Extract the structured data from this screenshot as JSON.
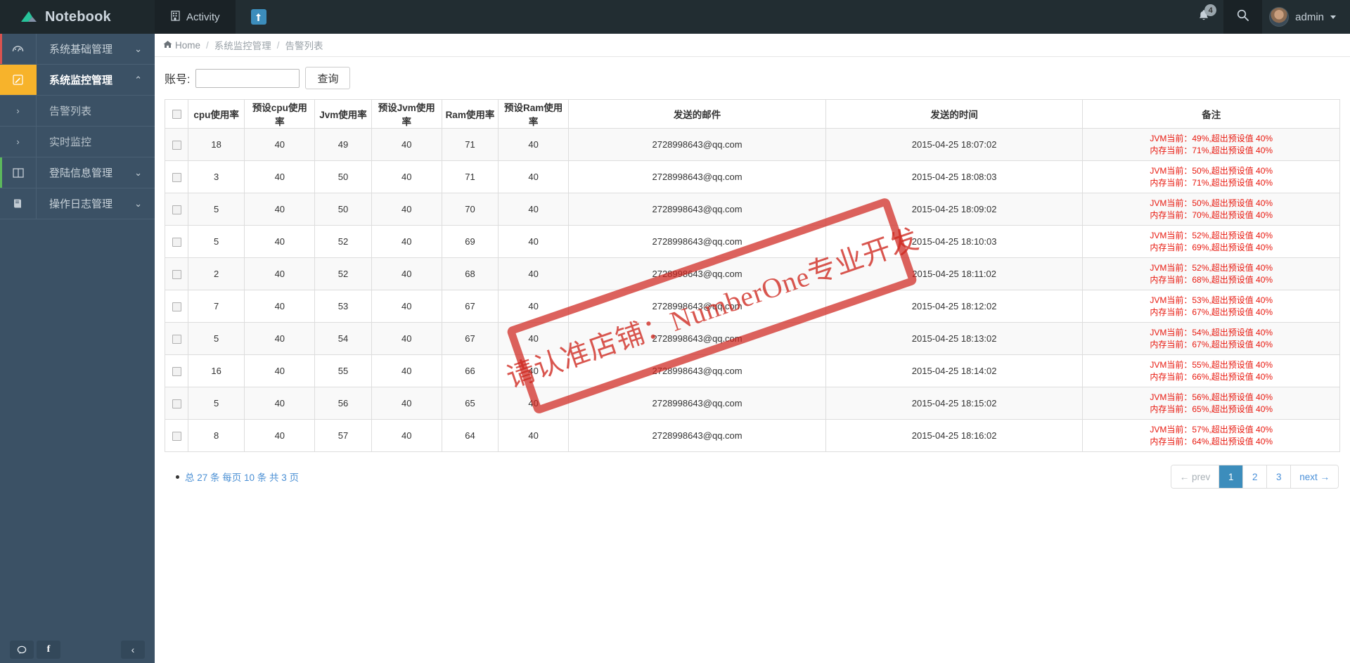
{
  "topbar": {
    "brand": "Notebook",
    "brand_logo_icon": "leaf-logo-icon",
    "nav": [
      {
        "label": "Activity",
        "icon": "building-icon"
      }
    ],
    "nav_badge_item": {
      "icon": "up-arrow-icon",
      "label": "↑"
    },
    "notifications": {
      "icon": "bell-icon",
      "count": "4"
    },
    "search": {
      "icon": "search-icon"
    },
    "user": {
      "name": "admin",
      "avatar_icon": "user-avatar"
    }
  },
  "sidebar": {
    "items": [
      {
        "label": "系统基础管理",
        "icon": "dashboard-icon",
        "chevron": "⌄",
        "state": "collapsed",
        "accent": "red"
      },
      {
        "label": "系统监控管理",
        "icon": "pencil-icon",
        "chevron": "⌃",
        "state": "expanded",
        "accent": "none"
      },
      {
        "label": "告警列表",
        "icon": "chevron-right-icon",
        "chevron": "",
        "state": "sub-active",
        "accent": "none"
      },
      {
        "label": "实时监控",
        "icon": "chevron-right-icon",
        "chevron": "",
        "state": "sub",
        "accent": "none"
      },
      {
        "label": "登陆信息管理",
        "icon": "columns-icon",
        "chevron": "⌄",
        "state": "collapsed",
        "accent": "green"
      },
      {
        "label": "操作日志管理",
        "icon": "book-icon",
        "chevron": "⌄",
        "state": "collapsed",
        "accent": "none"
      }
    ],
    "footer": {
      "chat_icon": "chat-bubble-icon",
      "facebook_icon": "facebook-icon",
      "facebook_label": "f",
      "collapse_icon": "chevron-left-icon",
      "collapse_label": "‹"
    }
  },
  "breadcrumb": {
    "home_icon": "home-icon",
    "home": "Home",
    "items": [
      "系统监控管理",
      "告警列表"
    ],
    "separator": "/"
  },
  "search": {
    "label": "账号:",
    "value": "",
    "placeholder": "",
    "button": "查询"
  },
  "table": {
    "headers": [
      "cpu使用率",
      "预设cpu使用率",
      "Jvm使用率",
      "预设Jvm使用率",
      "Ram使用率",
      "预设Ram使用率",
      "发送的邮件",
      "发送的时间",
      "备注"
    ],
    "rows": [
      {
        "cpu": "18",
        "cpu_preset": "40",
        "jvm": "49",
        "jvm_preset": "40",
        "ram": "71",
        "ram_preset": "40",
        "email": "2728998643@qq.com",
        "time": "2015-04-25 18:07:02",
        "remark_line1": "JVM当前：49%,超出预设值 40%",
        "remark_line2": "内存当前：71%,超出预设值 40%"
      },
      {
        "cpu": "3",
        "cpu_preset": "40",
        "jvm": "50",
        "jvm_preset": "40",
        "ram": "71",
        "ram_preset": "40",
        "email": "2728998643@qq.com",
        "time": "2015-04-25 18:08:03",
        "remark_line1": "JVM当前：50%,超出预设值 40%",
        "remark_line2": "内存当前：71%,超出预设值 40%"
      },
      {
        "cpu": "5",
        "cpu_preset": "40",
        "jvm": "50",
        "jvm_preset": "40",
        "ram": "70",
        "ram_preset": "40",
        "email": "2728998643@qq.com",
        "time": "2015-04-25 18:09:02",
        "remark_line1": "JVM当前：50%,超出预设值 40%",
        "remark_line2": "内存当前：70%,超出预设值 40%"
      },
      {
        "cpu": "5",
        "cpu_preset": "40",
        "jvm": "52",
        "jvm_preset": "40",
        "ram": "69",
        "ram_preset": "40",
        "email": "2728998643@qq.com",
        "time": "2015-04-25 18:10:03",
        "remark_line1": "JVM当前：52%,超出预设值 40%",
        "remark_line2": "内存当前：69%,超出预设值 40%"
      },
      {
        "cpu": "2",
        "cpu_preset": "40",
        "jvm": "52",
        "jvm_preset": "40",
        "ram": "68",
        "ram_preset": "40",
        "email": "2728998643@qq.com",
        "time": "2015-04-25 18:11:02",
        "remark_line1": "JVM当前：52%,超出预设值 40%",
        "remark_line2": "内存当前：68%,超出预设值 40%"
      },
      {
        "cpu": "7",
        "cpu_preset": "40",
        "jvm": "53",
        "jvm_preset": "40",
        "ram": "67",
        "ram_preset": "40",
        "email": "2728998643@qq.com",
        "time": "2015-04-25 18:12:02",
        "remark_line1": "JVM当前：53%,超出预设值 40%",
        "remark_line2": "内存当前：67%,超出预设值 40%"
      },
      {
        "cpu": "5",
        "cpu_preset": "40",
        "jvm": "54",
        "jvm_preset": "40",
        "ram": "67",
        "ram_preset": "40",
        "email": "2728998643@qq.com",
        "time": "2015-04-25 18:13:02",
        "remark_line1": "JVM当前：54%,超出预设值 40%",
        "remark_line2": "内存当前：67%,超出预设值 40%"
      },
      {
        "cpu": "16",
        "cpu_preset": "40",
        "jvm": "55",
        "jvm_preset": "40",
        "ram": "66",
        "ram_preset": "40",
        "email": "2728998643@qq.com",
        "time": "2015-04-25 18:14:02",
        "remark_line1": "JVM当前：55%,超出预设值 40%",
        "remark_line2": "内存当前：66%,超出预设值 40%"
      },
      {
        "cpu": "5",
        "cpu_preset": "40",
        "jvm": "56",
        "jvm_preset": "40",
        "ram": "65",
        "ram_preset": "40",
        "email": "2728998643@qq.com",
        "time": "2015-04-25 18:15:02",
        "remark_line1": "JVM当前：56%,超出预设值 40%",
        "remark_line2": "内存当前：65%,超出预设值 40%"
      },
      {
        "cpu": "8",
        "cpu_preset": "40",
        "jvm": "57",
        "jvm_preset": "40",
        "ram": "64",
        "ram_preset": "40",
        "email": "2728998643@qq.com",
        "time": "2015-04-25 18:16:02",
        "remark_line1": "JVM当前：57%,超出预设值 40%",
        "remark_line2": "内存当前：64%,超出预设值 40%"
      }
    ]
  },
  "pagination": {
    "summary": "总 27 条 每页 10 条 共 3 页",
    "prev": "← prev",
    "pages": [
      "1",
      "2",
      "3"
    ],
    "current": "1",
    "next": "next →"
  },
  "watermark": {
    "text": "请认准店铺：NumberOne专业开发"
  },
  "colors": {
    "accent": "#3c8dbc",
    "sidebar": "#3b5165",
    "topbar": "#222d32",
    "active_item": "#f7b32b",
    "danger_text": "#e8190f"
  }
}
